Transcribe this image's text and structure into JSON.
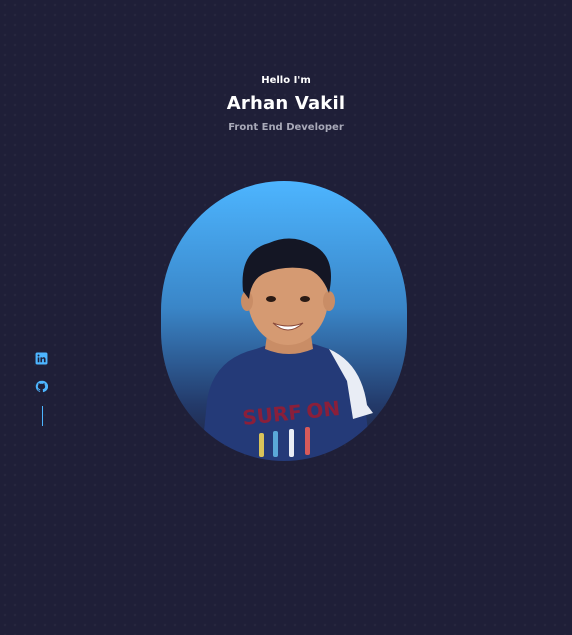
{
  "header": {
    "greeting": "Hello I'm",
    "name": "Arhan Vakil",
    "role": "Front End Developer"
  },
  "socials": [
    {
      "icon": "linkedin-icon"
    },
    {
      "icon": "github-icon"
    }
  ],
  "colors": {
    "background": "#1f1f38",
    "accent": "#4db5ff",
    "muted_text": "#a8a9b8"
  }
}
